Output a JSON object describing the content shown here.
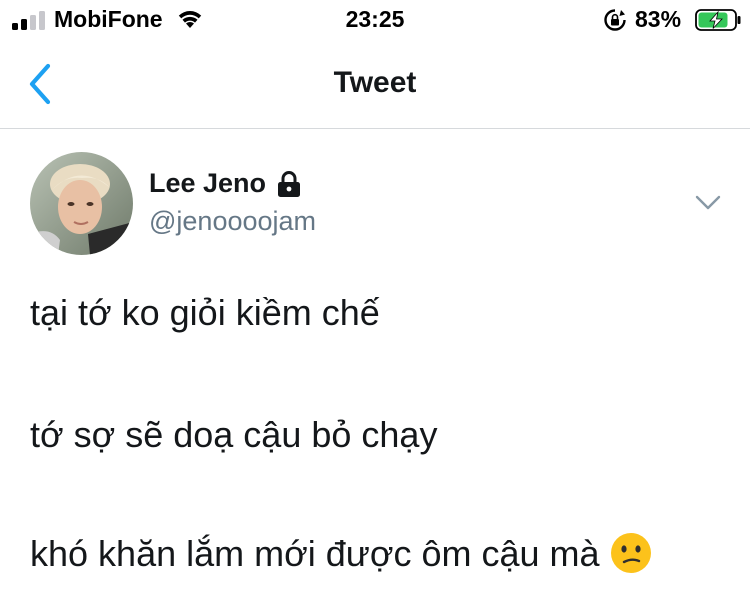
{
  "status_bar": {
    "carrier": "MobiFone",
    "time": "23:25",
    "battery_percent": "83%",
    "battery_level": 0.83,
    "battery_charging": true,
    "icons": [
      "signal-icon",
      "wifi-icon",
      "rotation-lock-icon",
      "battery-icon"
    ]
  },
  "nav": {
    "title": "Tweet",
    "back_icon": "chevron-left-icon"
  },
  "tweet": {
    "author": {
      "name": "Lee Jeno",
      "handle": "@jenoooojam",
      "protected": true,
      "avatar_icon": "profile-photo"
    },
    "menu_icon": "chevron-down-icon",
    "lines": [
      "tại tớ ko giỏi kiềm chế",
      "tớ sợ sẽ doạ cậu bỏ chạy",
      "khó khăn lắm mới được ôm cậu mà"
    ],
    "emoji": "confused-face-emoji"
  },
  "colors": {
    "accent": "#1da1f2",
    "text": "#14171a",
    "secondary_text": "#657786",
    "divider": "#d6d9dc",
    "battery_green": "#34c759",
    "emoji_yellow": "#fcc21b"
  }
}
